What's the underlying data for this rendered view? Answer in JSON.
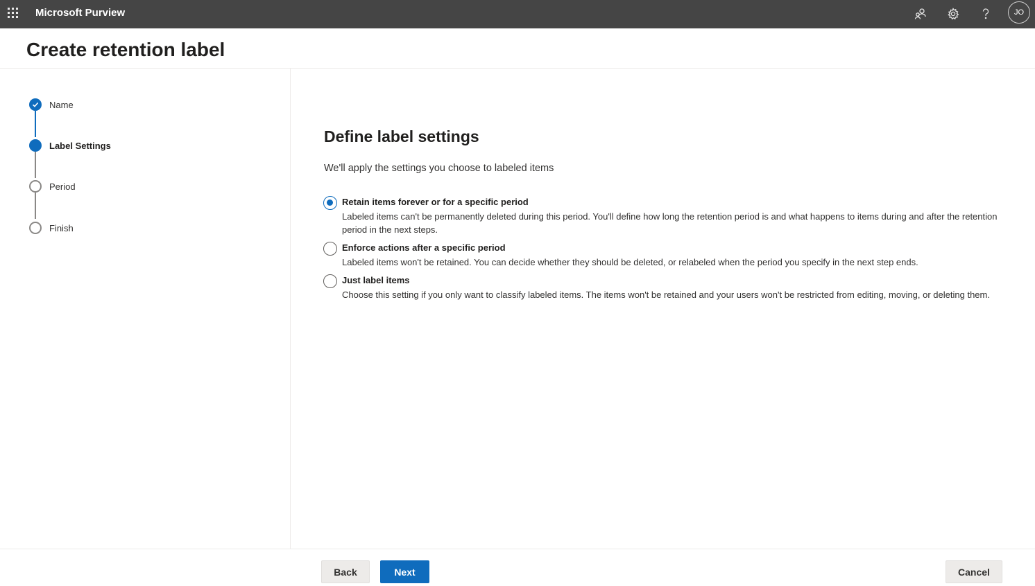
{
  "topbar": {
    "app_name": "Microsoft Purview",
    "avatar_initials": "JO",
    "icons": [
      "waffle-icon",
      "community-icon",
      "gear-icon",
      "help-icon"
    ]
  },
  "page": {
    "title": "Create retention label"
  },
  "steps": [
    {
      "label": "Name",
      "state": "completed"
    },
    {
      "label": "Label Settings",
      "state": "current"
    },
    {
      "label": "Period",
      "state": "pending"
    },
    {
      "label": "Finish",
      "state": "pending"
    }
  ],
  "main": {
    "title": "Define label settings",
    "subtitle": "We'll apply the settings you choose to labeled items",
    "selected_option": 0,
    "options": [
      {
        "title": "Retain items forever or for a specific period",
        "description": "Labeled items can't be permanently deleted during this period. You'll define how long the retention period is and what happens to items during and after the retention period in the next steps."
      },
      {
        "title": "Enforce actions after a specific period",
        "description": "Labeled items won't be retained. You can decide whether they should be deleted, or relabeled when the period you specify in the next step ends."
      },
      {
        "title": "Just label items",
        "description": "Choose this setting if you only want to classify labeled items. The items won't be retained and your users won't be restricted from editing, moving, or deleting them."
      }
    ]
  },
  "footer": {
    "back_label": "Back",
    "next_label": "Next",
    "cancel_label": "Cancel"
  },
  "colors": {
    "topbar": "#454545",
    "accent": "#0f6cbd"
  }
}
